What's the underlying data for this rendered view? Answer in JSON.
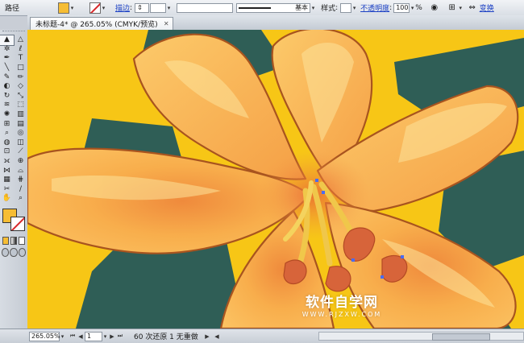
{
  "app": {
    "accent_color": "#f6bd34",
    "stroke_none_color": "#d7262a",
    "canvas_bg_color": "#f7c616",
    "leaf_color": "#2f5e56",
    "petal_color": "#fbbf57"
  },
  "control_bar": {
    "object_label": "路径",
    "stroke_label": "描边",
    "style_label": "基本",
    "style_caption": "样式",
    "opacity_label": "不透明度",
    "opacity_value": "100",
    "opacity_unit": "%",
    "transform_label": "变换"
  },
  "document": {
    "tab_title": "未标题-4* @ 265.05% (CMYK/预览)",
    "close_glyph": "✕"
  },
  "status": {
    "zoom": "265.05%",
    "page": "1",
    "history": "60 次还原 1 无重做"
  },
  "watermark": {
    "title": "软件自学网",
    "url": "WWW.RJZXW.COM"
  },
  "tools": [
    {
      "name": "selection-tool",
      "glyph": "▲",
      "selected": true
    },
    {
      "name": "direct-selection-tool",
      "glyph": "△",
      "selected": false
    },
    {
      "name": "magic-wand-tool",
      "glyph": "✲",
      "selected": false
    },
    {
      "name": "lasso-tool",
      "glyph": "ℓ",
      "selected": false
    },
    {
      "name": "pen-tool",
      "glyph": "✒",
      "selected": false
    },
    {
      "name": "type-tool",
      "glyph": "T",
      "selected": false
    },
    {
      "name": "line-tool",
      "glyph": "╲",
      "selected": false
    },
    {
      "name": "rectangle-tool",
      "glyph": "□",
      "selected": false
    },
    {
      "name": "paintbrush-tool",
      "glyph": "✎",
      "selected": false
    },
    {
      "name": "pencil-tool",
      "glyph": "✏",
      "selected": false
    },
    {
      "name": "blob-brush-tool",
      "glyph": "◐",
      "selected": false
    },
    {
      "name": "eraser-tool",
      "glyph": "◇",
      "selected": false
    },
    {
      "name": "rotate-tool",
      "glyph": "↻",
      "selected": false
    },
    {
      "name": "scale-tool",
      "glyph": "⤡",
      "selected": false
    },
    {
      "name": "warp-tool",
      "glyph": "≋",
      "selected": false
    },
    {
      "name": "free-transform-tool",
      "glyph": "⬚",
      "selected": false
    },
    {
      "name": "symbol-sprayer-tool",
      "glyph": "✺",
      "selected": false
    },
    {
      "name": "column-graph-tool",
      "glyph": "▥",
      "selected": false
    },
    {
      "name": "mesh-tool",
      "glyph": "⊞",
      "selected": false
    },
    {
      "name": "gradient-tool",
      "glyph": "▤",
      "selected": false
    },
    {
      "name": "eyedropper-tool",
      "glyph": "⌕",
      "selected": false
    },
    {
      "name": "blend-tool",
      "glyph": "◎",
      "selected": false
    },
    {
      "name": "live-paint-bucket-tool",
      "glyph": "◍",
      "selected": false
    },
    {
      "name": "live-paint-selection-tool",
      "glyph": "◫",
      "selected": false
    },
    {
      "name": "artboard-tool",
      "glyph": "⊡",
      "selected": false
    },
    {
      "name": "slice-tool",
      "glyph": "⟋",
      "selected": false
    },
    {
      "name": "width-tool",
      "glyph": "⟗",
      "selected": false
    },
    {
      "name": "shape-builder-tool",
      "glyph": "⊕",
      "selected": false
    },
    {
      "name": "perspective-grid-tool",
      "glyph": "⋈",
      "selected": false
    },
    {
      "name": "perspective-selection-tool",
      "glyph": "⌓",
      "selected": false
    },
    {
      "name": "graph-tool",
      "glyph": "▦",
      "selected": false
    },
    {
      "name": "mesh-alt-tool",
      "glyph": "⋕",
      "selected": false
    },
    {
      "name": "scissors-tool",
      "glyph": "✂",
      "selected": false
    },
    {
      "name": "knife-tool",
      "glyph": "∕",
      "selected": false
    },
    {
      "name": "hand-tool",
      "glyph": "✋",
      "selected": false
    },
    {
      "name": "zoom-tool",
      "glyph": "⌕",
      "selected": false
    }
  ]
}
